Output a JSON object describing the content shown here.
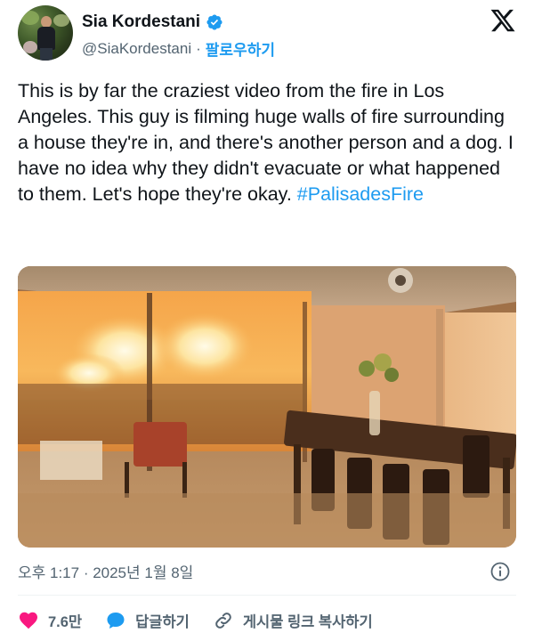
{
  "author": {
    "display_name": "Sia Kordestani",
    "handle": "@SiaKordestani",
    "separator": "·",
    "follow_label": "팔로우하기"
  },
  "tweet": {
    "text": "This is by far the craziest video from the fire in Los Angeles. This guy is filming huge walls of fire surrounding a house they're in, and there's another person and a dog. I have no idea why they didn't evacuate or what happened to them. Let's hope they're okay.",
    "hashtag": "#PalisadesFire",
    "timestamp": "오후 1:17 · 2025년 1월 8일"
  },
  "actions": {
    "like_count": "7.6만",
    "reply_label": "답글하기",
    "copy_link_label": "게시물 링크 복사하기"
  },
  "icons": {
    "verified": "verified-badge-icon",
    "x_logo": "x-logo-icon",
    "info": "info-icon",
    "like": "heart-icon",
    "reply": "reply-bubble-icon",
    "link": "link-icon"
  },
  "colors": {
    "accent": "#1d9bf0",
    "like": "#f91880",
    "secondary_text": "#536471",
    "primary_text": "#0f1419"
  }
}
